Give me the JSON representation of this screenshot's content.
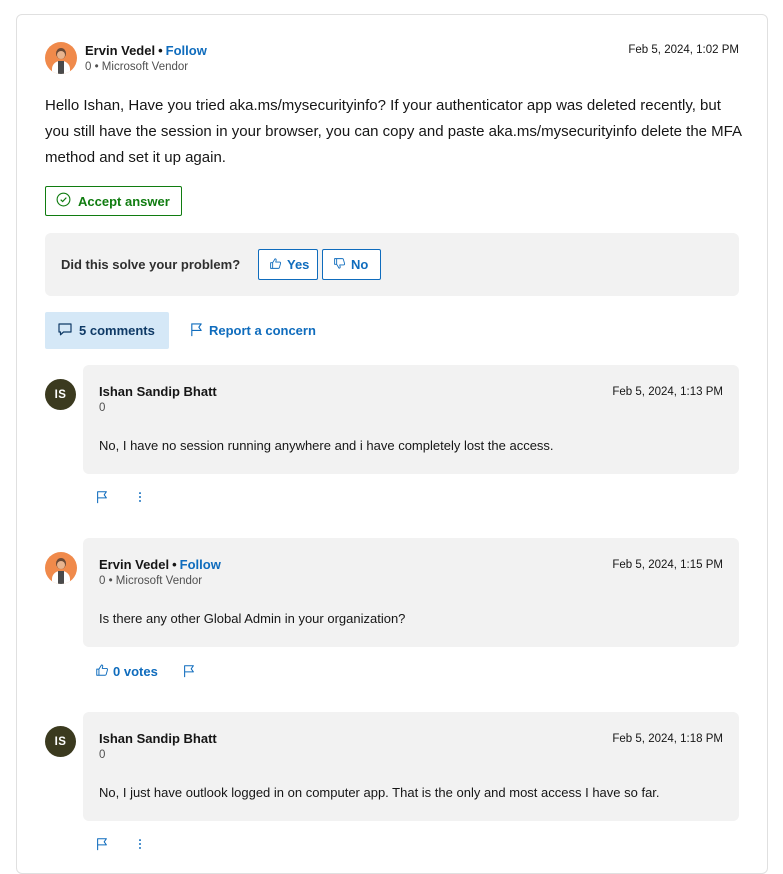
{
  "answer": {
    "author": "Ervin Vedel",
    "separator": "•",
    "follow_label": "Follow",
    "meta": "0 • Microsoft Vendor",
    "date": "Feb 5, 2024, 1:02 PM",
    "body": "Hello Ishan, Have you tried aka.ms/mysecurityinfo? If your authenticator app was deleted recently, but you still have the session in your browser, you can copy and paste aka.ms/mysecurityinfo delete the MFA method and set it up again.",
    "accept_label": "Accept answer"
  },
  "feedback": {
    "question": "Did this solve your problem?",
    "yes_label": "Yes",
    "no_label": "No"
  },
  "actions": {
    "comments_label": "5 comments",
    "report_label": "Report a concern"
  },
  "comments": [
    {
      "initials": "IS",
      "author": "Ishan Sandip Bhatt",
      "meta": "0",
      "date": "Feb 5, 2024, 1:13 PM",
      "text": "No, I have no session running anywhere and i have completely lost the access."
    },
    {
      "author": "Ervin Vedel",
      "separator": "•",
      "follow_label": "Follow",
      "meta": "0 • Microsoft Vendor",
      "date": "Feb 5, 2024, 1:15 PM",
      "text": "Is there any other Global Admin in your organization?",
      "votes_label": "0 votes"
    },
    {
      "initials": "IS",
      "author": "Ishan Sandip Bhatt",
      "meta": "0",
      "date": "Feb 5, 2024, 1:18 PM",
      "text": "No, I just have outlook logged in on computer app. That is the only and most access I have so far."
    }
  ],
  "icons": {
    "accept": "check-circle-icon",
    "yes": "thumbs-up-icon",
    "no": "thumbs-down-icon",
    "comments": "comment-icon",
    "report": "flag-icon",
    "more": "more-vertical-icon"
  },
  "colors": {
    "link": "#0f6cbd",
    "accept": "#107c10",
    "panel": "#f2f2f2",
    "comments_bg": "#d5e8f7",
    "avatar_initials_bg": "#3b3a1f",
    "avatar_photo_bg": "#f08a4b"
  }
}
